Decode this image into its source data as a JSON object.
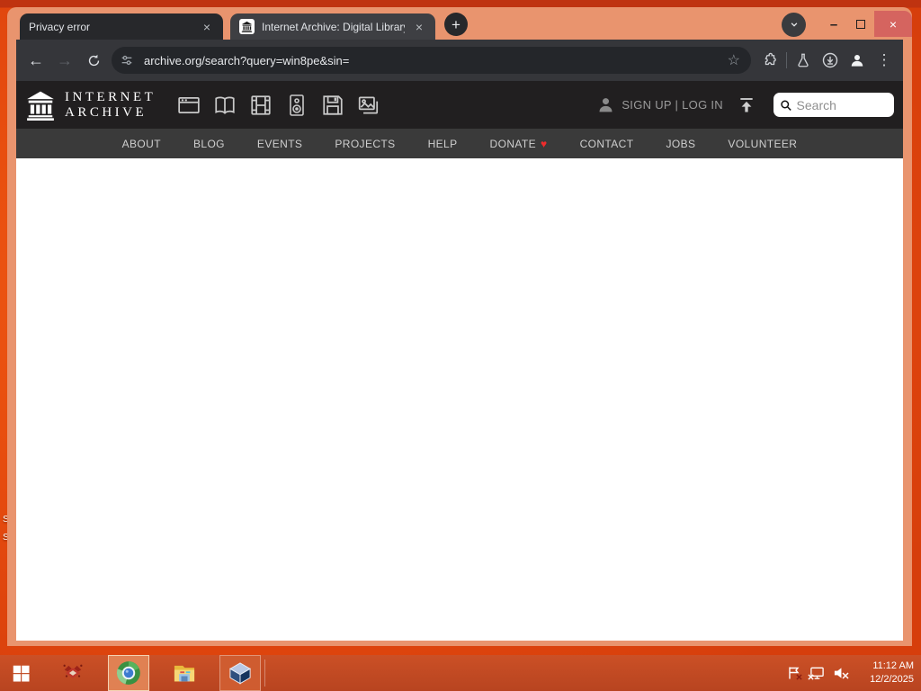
{
  "colors": {
    "desktop_orange": "#e54a0e",
    "window_frame_salmon": "#e9946e",
    "close_button_red": "#d5645f",
    "toolbar_dark": "#35363a",
    "archive_header_dark": "#211f20",
    "archive_nav_gray": "#3a3a3a",
    "donate_heart_red": "#ef2c2c",
    "taskbar_red": "#c44d24"
  },
  "icons": {
    "plus": "+",
    "close": "×",
    "back": "←",
    "forward": "→",
    "kebab": "⋮",
    "minimize": "–",
    "star": "☆",
    "heart": "♥"
  },
  "browser": {
    "tabs": [
      {
        "title": "Privacy error"
      },
      {
        "title": "Internet Archive: Digital Library"
      }
    ],
    "url": "archive.org/search?query=win8pe&sin="
  },
  "archive": {
    "wordmark_line1": "INTERNET",
    "wordmark_line2": "ARCHIVE",
    "auth_text": "SIGN UP | LOG IN",
    "search_placeholder": "Search",
    "nav_items": [
      "ABOUT",
      "BLOG",
      "EVENTS",
      "PROJECTS",
      "HELP",
      "DONATE",
      "CONTACT",
      "JOBS",
      "VOLUNTEER"
    ]
  },
  "taskbar": {
    "time": "11:12 AM",
    "date": "12/2/2025"
  },
  "desktop": {
    "partial_icon_labels": [
      "S",
      "S"
    ]
  }
}
